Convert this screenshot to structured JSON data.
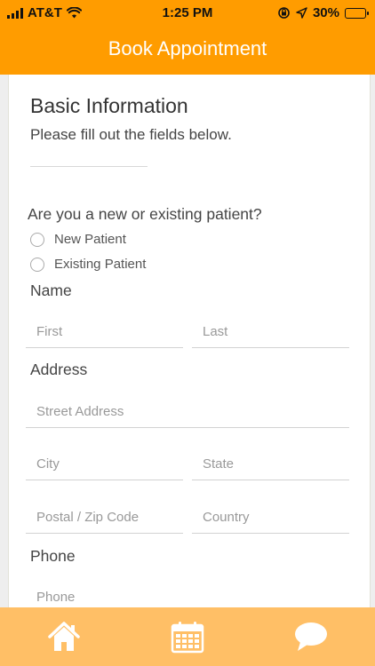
{
  "status_bar": {
    "carrier": "AT&T",
    "time": "1:25 PM",
    "battery": "30%",
    "battery_level": 0.3
  },
  "header": {
    "title": "Book Appointment"
  },
  "basic_info": {
    "title": "Basic Information",
    "subtitle": "Please fill out the fields below."
  },
  "patient_type": {
    "question": "Are you a new or existing patient?",
    "options": [
      "New Patient",
      "Existing Patient"
    ]
  },
  "name": {
    "label": "Name",
    "first_placeholder": "First",
    "last_placeholder": "Last"
  },
  "address": {
    "label": "Address",
    "street_placeholder": "Street Address",
    "city_placeholder": "City",
    "state_placeholder": "State",
    "zip_placeholder": "Postal / Zip Code",
    "country_placeholder": "Country"
  },
  "phone": {
    "label": "Phone",
    "placeholder": "Phone"
  },
  "tabbar": {
    "items": [
      "home-icon",
      "calendar-icon",
      "chat-icon"
    ]
  },
  "colors": {
    "header": "#ff9c00",
    "tabbar": "#ffbf66"
  }
}
